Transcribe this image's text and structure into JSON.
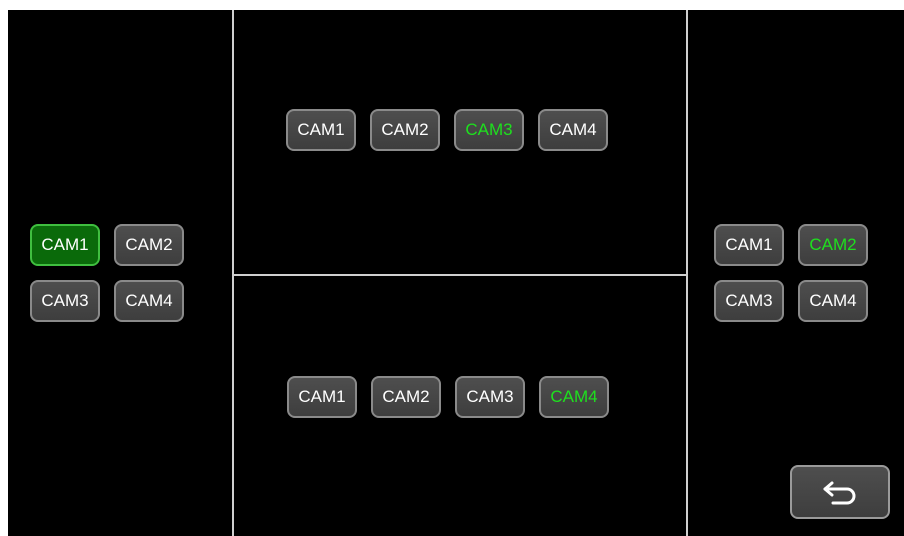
{
  "colors": {
    "screen_background": "#000000",
    "button_fill": "#4a4a4a",
    "button_border": "#8a8a8a",
    "active_fill": "#0a6a0a",
    "active_text": "#1ee01e"
  },
  "left_panel": {
    "buttons": [
      {
        "label": "CAM1",
        "state": "selected-fill"
      },
      {
        "label": "CAM2",
        "state": "normal"
      },
      {
        "label": "CAM3",
        "state": "normal"
      },
      {
        "label": "CAM4",
        "state": "normal"
      }
    ]
  },
  "top_center_panel": {
    "buttons": [
      {
        "label": "CAM1",
        "state": "normal"
      },
      {
        "label": "CAM2",
        "state": "normal"
      },
      {
        "label": "CAM3",
        "state": "selected-text"
      },
      {
        "label": "CAM4",
        "state": "normal"
      }
    ]
  },
  "bottom_center_panel": {
    "buttons": [
      {
        "label": "CAM1",
        "state": "normal"
      },
      {
        "label": "CAM2",
        "state": "normal"
      },
      {
        "label": "CAM3",
        "state": "normal"
      },
      {
        "label": "CAM4",
        "state": "selected-text"
      }
    ]
  },
  "right_panel": {
    "buttons": [
      {
        "label": "CAM1",
        "state": "normal"
      },
      {
        "label": "CAM2",
        "state": "selected-text"
      },
      {
        "label": "CAM3",
        "state": "normal"
      },
      {
        "label": "CAM4",
        "state": "normal"
      }
    ]
  },
  "back_button": {
    "icon": "return-arrow-icon"
  }
}
